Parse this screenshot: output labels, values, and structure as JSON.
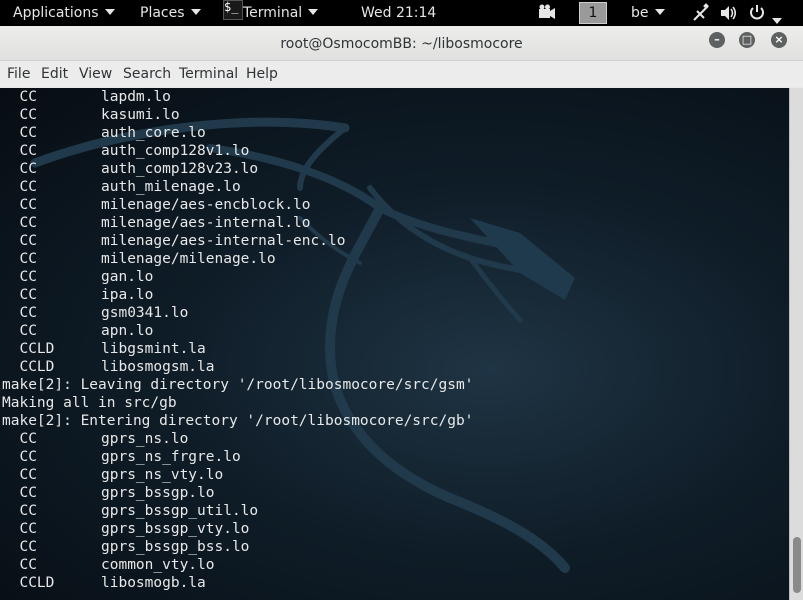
{
  "panel": {
    "applications": "Applications",
    "places": "Places",
    "terminal_icon": "$_",
    "terminal": "Terminal",
    "clock": "Wed 21:14",
    "workspace": "1",
    "keyboard_layout": "be",
    "icons": [
      "camera-icon",
      "network-icon",
      "volume-icon",
      "power-icon"
    ]
  },
  "window": {
    "title": "root@OsmocomBB: ~/libosmocore",
    "controls": [
      "minimize-icon",
      "maximize-icon",
      "close-icon"
    ]
  },
  "menubar": [
    "File",
    "Edit",
    "View",
    "Search",
    "Terminal",
    "Help"
  ],
  "terminal": {
    "lines": [
      {
        "tag": "  CC",
        "text": "lapdm.lo"
      },
      {
        "tag": "  CC",
        "text": "kasumi.lo"
      },
      {
        "tag": "  CC",
        "text": "auth_core.lo"
      },
      {
        "tag": "  CC",
        "text": "auth_comp128v1.lo"
      },
      {
        "tag": "  CC",
        "text": "auth_comp128v23.lo"
      },
      {
        "tag": "  CC",
        "text": "auth_milenage.lo"
      },
      {
        "tag": "  CC",
        "text": "milenage/aes-encblock.lo"
      },
      {
        "tag": "  CC",
        "text": "milenage/aes-internal.lo"
      },
      {
        "tag": "  CC",
        "text": "milenage/aes-internal-enc.lo"
      },
      {
        "tag": "  CC",
        "text": "milenage/milenage.lo"
      },
      {
        "tag": "  CC",
        "text": "gan.lo"
      },
      {
        "tag": "  CC",
        "text": "ipa.lo"
      },
      {
        "tag": "  CC",
        "text": "gsm0341.lo"
      },
      {
        "tag": "  CC",
        "text": "apn.lo"
      },
      {
        "tag": "  CCLD",
        "text": "libgsmint.la"
      },
      {
        "tag": "  CCLD",
        "text": "libosmogsm.la"
      },
      {
        "tag": "",
        "text": "make[2]: Leaving directory '/root/libosmocore/src/gsm'"
      },
      {
        "tag": "",
        "text": "Making all in src/gb"
      },
      {
        "tag": "",
        "text": "make[2]: Entering directory '/root/libosmocore/src/gb'"
      },
      {
        "tag": "  CC",
        "text": "gprs_ns.lo"
      },
      {
        "tag": "  CC",
        "text": "gprs_ns_frgre.lo"
      },
      {
        "tag": "  CC",
        "text": "gprs_ns_vty.lo"
      },
      {
        "tag": "  CC",
        "text": "gprs_bssgp.lo"
      },
      {
        "tag": "  CC",
        "text": "gprs_bssgp_util.lo"
      },
      {
        "tag": "  CC",
        "text": "gprs_bssgp_vty.lo"
      },
      {
        "tag": "  CC",
        "text": "gprs_bssgp_bss.lo"
      },
      {
        "tag": "  CC",
        "text": "common_vty.lo"
      },
      {
        "tag": "  CCLD",
        "text": "libosmogb.la"
      }
    ]
  },
  "colors": {
    "panel_bg": "#000000",
    "terminal_bg": "#0f1d28",
    "terminal_text": "#e8e8e8",
    "titlebar_bg": "#e8e8e7"
  }
}
